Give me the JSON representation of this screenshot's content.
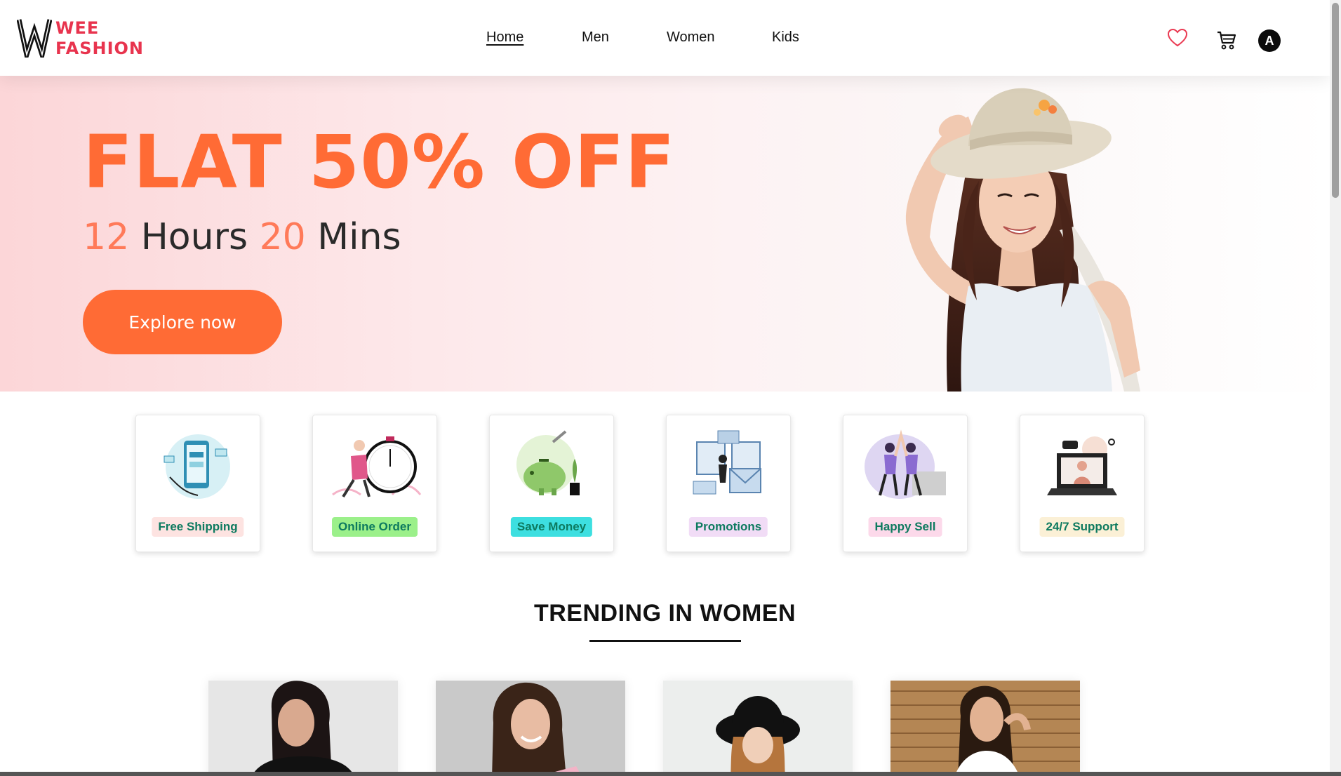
{
  "brand": {
    "logo_mark": "W",
    "line1": "WEE",
    "line2": "FASHION",
    "color": "#e8344e"
  },
  "nav": {
    "items": [
      "Home",
      "Men",
      "Women",
      "Kids"
    ],
    "active": "Home"
  },
  "header_icons": [
    "heart-icon",
    "cart-icon"
  ],
  "user": {
    "initial": "A"
  },
  "hero": {
    "title": "FLAT 50% OFF",
    "hours": "12",
    "hours_label": "Hours",
    "mins": "20",
    "mins_label": "Mins",
    "cta": "Explore now",
    "accent": "#ff6b35"
  },
  "features": [
    {
      "label": "Free Shipping",
      "badge_color": "#fde3e1"
    },
    {
      "label": "Online Order",
      "badge_color": "#9bf08a"
    },
    {
      "label": "Save Money",
      "badge_color": "#3ddfe0"
    },
    {
      "label": "Promotions",
      "badge_color": "#f1dcf6"
    },
    {
      "label": "Happy Sell",
      "badge_color": "#fcd9ea"
    },
    {
      "label": "24/7 Support",
      "badge_color": "#fbf0d6"
    }
  ],
  "trending": {
    "title": "TRENDING IN WOMEN"
  }
}
